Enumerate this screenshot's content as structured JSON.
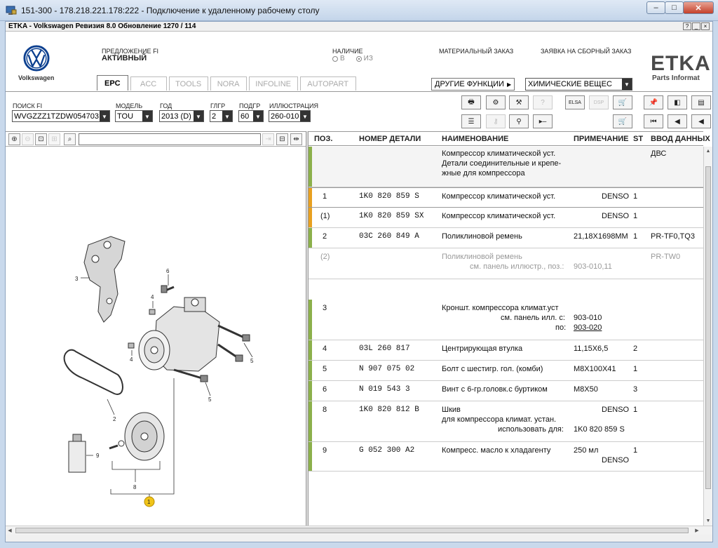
{
  "window": {
    "title": "151-300 - 178.218.221.178:222 - Подключение к удаленному рабочему столу",
    "minimize": "–",
    "maximize": "□",
    "close": "✕"
  },
  "app": {
    "title": "ETKA - Volkswagen Ревизия 8.0 Обновление 1270 / 114",
    "help_btn": "?",
    "min_btn": "_",
    "close_btn": "×"
  },
  "header": {
    "brand": "Volkswagen",
    "offer_label": "ПРЕДЛОЖЕНИЕ FI",
    "offer_value": "АКТИВНЫЙ",
    "availability_label": "НАЛИЧИЕ",
    "radio_in": "В",
    "radio_out": "ИЗ",
    "material_order": "МАТЕРИАЛЬНЫЙ ЗАКАЗ",
    "assembly_order": "ЗАЯВКА НА СБОРНЫЙ ЗАКАЗ",
    "etka_logo": "ETKA",
    "etka_sub": "Parts Informat",
    "other_functions": "ДРУГИЕ ФУНКЦИИ",
    "chemicals": "ХИМИЧЕСКИЕ ВЕЩЕС"
  },
  "tabs": [
    "EPC",
    "ACC",
    "TOOLS",
    "NORA",
    "INFOLINE",
    "AUTOPART"
  ],
  "filters": {
    "search_fi_label": "ПОИСК FI",
    "search_fi_value": "WVGZZZ1TZDW054703",
    "model_label": "МОДЕЛЬ",
    "model_value": "TOU",
    "year_label": "ГОД",
    "year_value": "2013 (D)",
    "mgroup_label": "ГЛГР",
    "mgroup_value": "2",
    "subgroup_label": "ПОДГР",
    "subgroup_value": "60",
    "illustration_label": "ИЛЛЮСТРАЦИЯ",
    "illustration_value": "260-010"
  },
  "toolbar": {
    "btn_elsa": "ELSA",
    "btn_dsp": "DSP",
    "btn_cart": "🛒"
  },
  "columns": {
    "pos": "ПОЗ.",
    "part_no": "НОМЕР ДЕТАЛИ",
    "name": "НАИМЕНОВАНИЕ",
    "note": "ПРИМЕЧАНИЕ",
    "st": "ST",
    "data_input": "ВВОД ДАННЫХ"
  },
  "parts": {
    "r0": {
      "name1": "Компрессор климатической уст.",
      "name2": "Детали соединительные и крепе-",
      "name3": "жные для компрессора",
      "data": "ДВС"
    },
    "r1": {
      "pos": "1",
      "part": "1K0  820  859  S",
      "name": "Компрессор климатической уст.",
      "note": "DENSO",
      "st": "1"
    },
    "r2": {
      "pos": "(1)",
      "part": "1K0  820  859  SX",
      "name": "Компрессор климатической уст.",
      "note": "DENSO",
      "st": "1"
    },
    "r3": {
      "pos": "2",
      "part": "03C  260  849  A",
      "name": "Поликлиновой ремень",
      "note": "21,18X1698MM",
      "st": "1",
      "data": "PR-TF0,TQ3"
    },
    "r4": {
      "pos": "(2)",
      "name": "Поликлиновой ремень",
      "name2": "см. панель иллюстр., поз.:",
      "note": "903-010,11",
      "data": "PR-TW0"
    },
    "r5": {
      "pos": "3",
      "name": "Кроншт. компрессора климат.уст",
      "name2": "см. панель илл. с:",
      "note": "903-010",
      "name3": "по:",
      "note2": "903-020"
    },
    "r6": {
      "pos": "4",
      "part": "03L  260  817",
      "name": "Центрирующая втулка",
      "note": "11,15X6,5",
      "st": "2"
    },
    "r7": {
      "pos": "5",
      "part": "N    907  075  02",
      "name": "Болт с шестигр. гол. (комби)",
      "note": "M8X100X41",
      "st": "1"
    },
    "r8": {
      "pos": "6",
      "part": "N    019  543  3",
      "name": "Винт с 6-гр.головк.с буртиком",
      "note": "M8X50",
      "st": "3"
    },
    "r9": {
      "pos": "8",
      "part": "1K0  820  812  B",
      "name": "Шкив",
      "note": "DENSO",
      "st": "1",
      "name2": "для компрессора климат. устан.",
      "name3": "использовать для:",
      "note2": "1K0 820 859 S"
    },
    "r10": {
      "pos": "9",
      "part": "G    052  300  A2",
      "name": "Компресс. масло к хладагенту",
      "note": "250 мл",
      "st": "1",
      "note2": "DENSO"
    }
  },
  "callouts": {
    "c1": "1",
    "c2a": "2",
    "c2b": "2",
    "c3": "3",
    "c4a": "4",
    "c4b": "4",
    "c5a": "5",
    "c5b": "5",
    "c6": "6",
    "c8": "8",
    "c9": "9"
  },
  "colors": {
    "row_bar": "#8cb04b",
    "row_bar_selected": "#e8a020",
    "callout_highlight": "#f0c419"
  }
}
